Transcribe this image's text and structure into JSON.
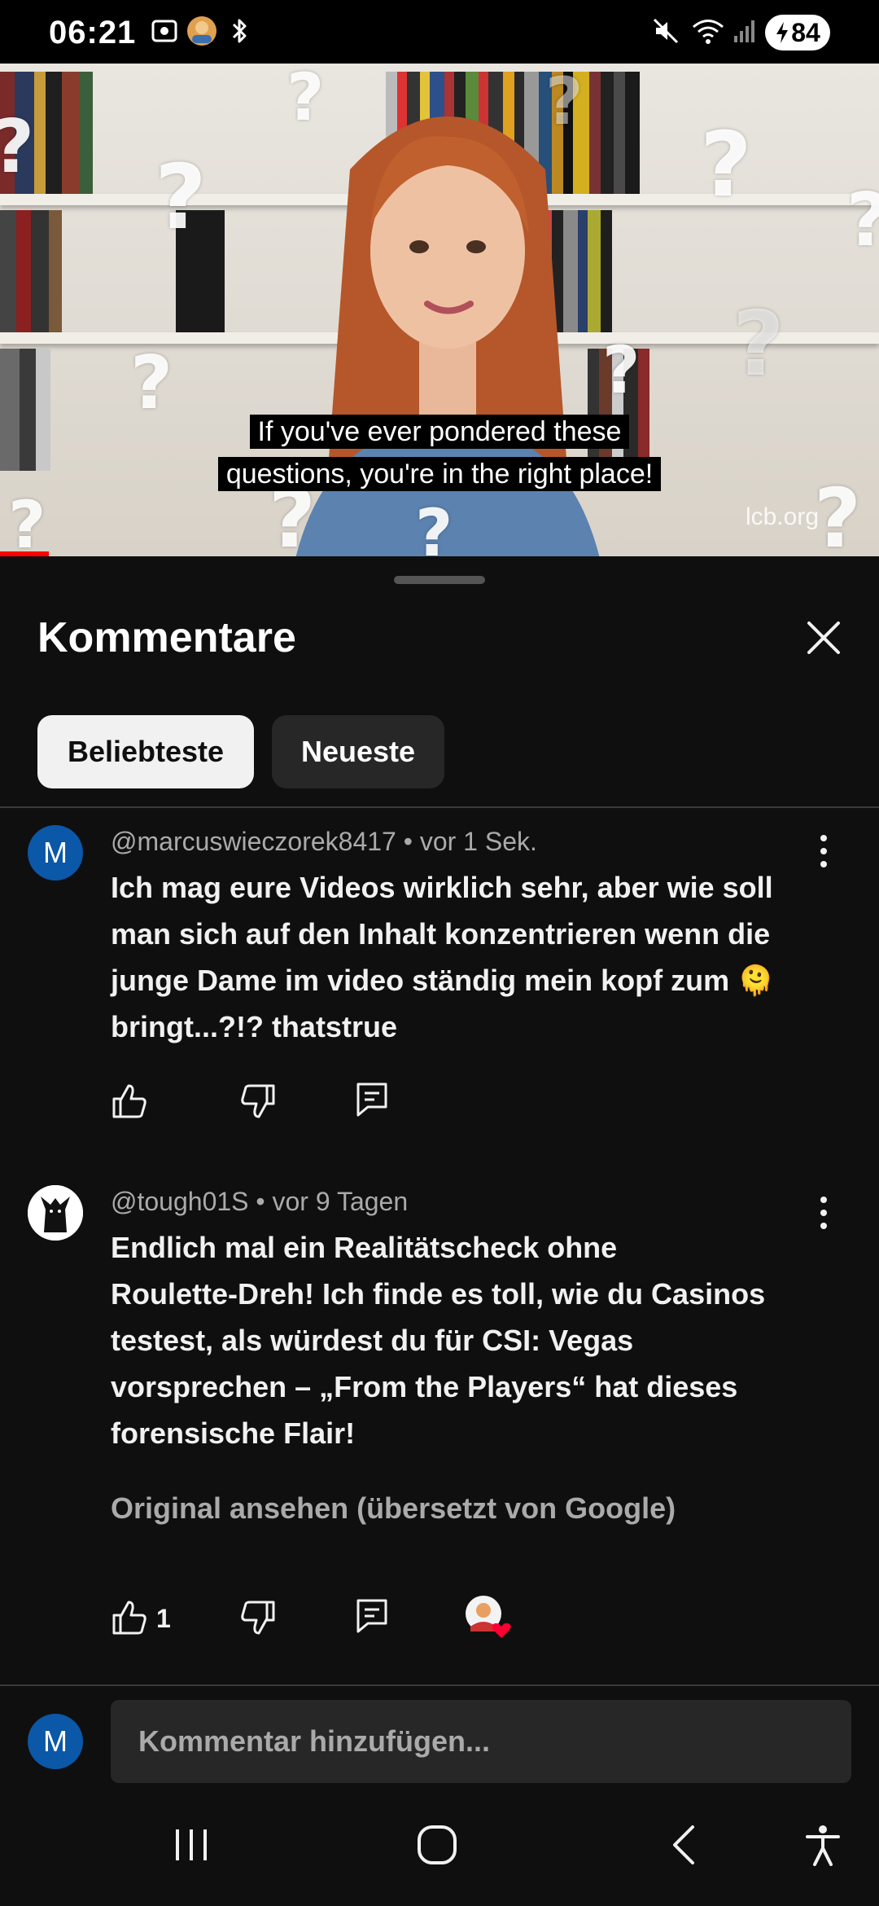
{
  "status_bar": {
    "time": "06:21",
    "battery": "84",
    "icons": [
      "screenshot-icon",
      "app-avatar-icon",
      "bluetooth-icon",
      "mute-icon",
      "wifi-icon",
      "signal-icon",
      "battery-charging-icon"
    ]
  },
  "video": {
    "caption_line1": "If you've ever pondered these",
    "caption_line2": "questions, you're in the right place!",
    "watermark": "lcb.org"
  },
  "sheet": {
    "title": "Kommentare",
    "filters": [
      {
        "label": "Beliebteste",
        "active": true
      },
      {
        "label": "Neueste",
        "active": false
      }
    ]
  },
  "comments": [
    {
      "avatar_letter": "M",
      "author": "@marcuswieczorek8417",
      "age": "vor 1 Sek.",
      "meta": "@marcuswieczorek8417 • vor 1 Sek.",
      "lines": [
        "Ich mag eure Videos wirklich sehr, aber wie soll",
        "man sich auf den Inhalt konzentrieren wenn die",
        "junge Dame im video ständig mein kopf zum 🫠",
        "bringt...?!?  thatstrue"
      ],
      "likes": ""
    },
    {
      "avatar_letter": "",
      "author": "@tough01S",
      "age": "vor 9 Tagen",
      "meta": "@tough01S • vor 9 Tagen",
      "lines": [
        "Endlich mal ein Realitätscheck ohne",
        "Roulette-Dreh! Ich finde es toll, wie du Casinos",
        "testest, als würdest du für CSI: Vegas",
        "vorsprechen – „From the Players“ hat dieses",
        "forensische Flair!"
      ],
      "translate_link": "Original ansehen (übersetzt von Google)",
      "likes": "1"
    }
  ],
  "input": {
    "avatar_letter": "M",
    "placeholder": "Kommentar hinzufügen..."
  },
  "colors": {
    "background": "#0f0f0f",
    "avatar_blue": "#0b57a8",
    "chip_active": "#f1f1f1",
    "chip_inactive": "#272727",
    "heart": "#ff0033"
  }
}
